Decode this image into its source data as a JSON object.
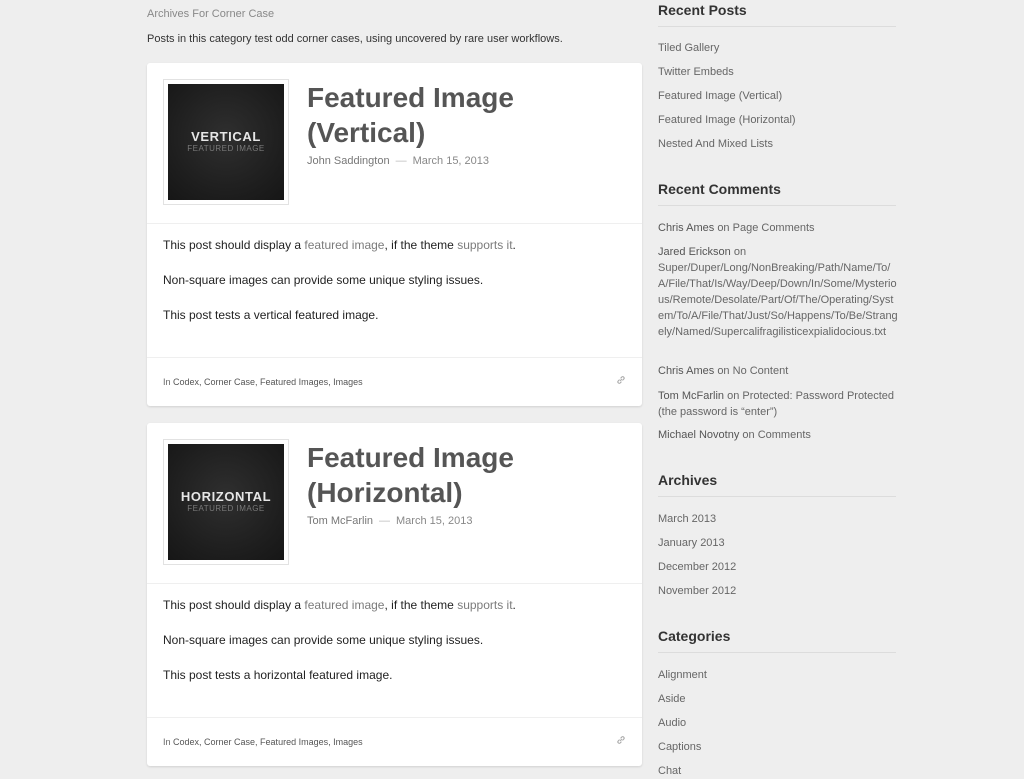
{
  "archive": {
    "title": "Archives For Corner Case",
    "description": "Posts in this category test odd corner cases, using uncovered by rare user workflows."
  },
  "posts": [
    {
      "thumb_big": "VERTICAL",
      "thumb_small": "FEATURED IMAGE",
      "title": "Featured Image (Vertical)",
      "author": "John Saddington",
      "sep": "—",
      "date": "March 15, 2013",
      "p1_before": "This post should display a ",
      "p1_link1": "featured image",
      "p1_mid": ", if the theme ",
      "p1_link2": "supports it",
      "p1_after": ".",
      "p2": "Non-square images can provide some unique styling issues.",
      "p3": "This post tests a vertical featured image.",
      "cats_prefix": "In ",
      "cats": "Codex, Corner Case, Featured Images, Images"
    },
    {
      "thumb_big": "HORIZONTAL",
      "thumb_small": "FEATURED IMAGE",
      "title": "Featured Image (Horizontal)",
      "author": "Tom McFarlin",
      "sep": "—",
      "date": "March 15, 2013",
      "p1_before": "This post should display a ",
      "p1_link1": "featured image",
      "p1_mid": ", if the theme ",
      "p1_link2": "supports it",
      "p1_after": ".",
      "p2": "Non-square images can provide some unique styling issues.",
      "p3": "This post tests a horizontal featured image.",
      "cats_prefix": "In ",
      "cats": "Codex, Corner Case, Featured Images, Images"
    }
  ],
  "sidebar": {
    "recent_posts": {
      "title": "Recent Posts",
      "items": [
        "Tiled Gallery",
        "Twitter Embeds",
        "Featured Image (Vertical)",
        "Featured Image (Horizontal)",
        "Nested And Mixed Lists"
      ]
    },
    "recent_comments": {
      "title": "Recent Comments",
      "on": "on",
      "items": [
        {
          "name": "Chris Ames",
          "post": "Page Comments"
        },
        {
          "name": "Jared Erickson",
          "post": "Super/Duper/Long/NonBreaking/Path/Name/To/A/File/That/Is/Way/Deep/Down/In/Some/Mysterious/Remote/Desolate/Part/Of/The/Operating/System/To/A/File/That/Just/So/Happens/To/Be/Strangely/Named/Supercalifragilisticexpialidocious.txt"
        },
        {
          "name": "Chris Ames",
          "post": "No Content"
        },
        {
          "name": "Tom McFarlin",
          "post": "Protected: Password Protected (the password is “enter”)"
        },
        {
          "name": "Michael Novotny",
          "post": "Comments"
        }
      ]
    },
    "archives": {
      "title": "Archives",
      "items": [
        "March 2013",
        "January 2013",
        "December 2012",
        "November 2012"
      ]
    },
    "categories": {
      "title": "Categories",
      "items": [
        "Alignment",
        "Aside",
        "Audio",
        "Captions",
        "Chat"
      ]
    }
  },
  "colors": {
    "background": "#eeeeee",
    "card": "#ffffff",
    "title": "#555555",
    "link": "#7b7b7b"
  },
  "icons": {
    "permalink": "link-icon"
  }
}
